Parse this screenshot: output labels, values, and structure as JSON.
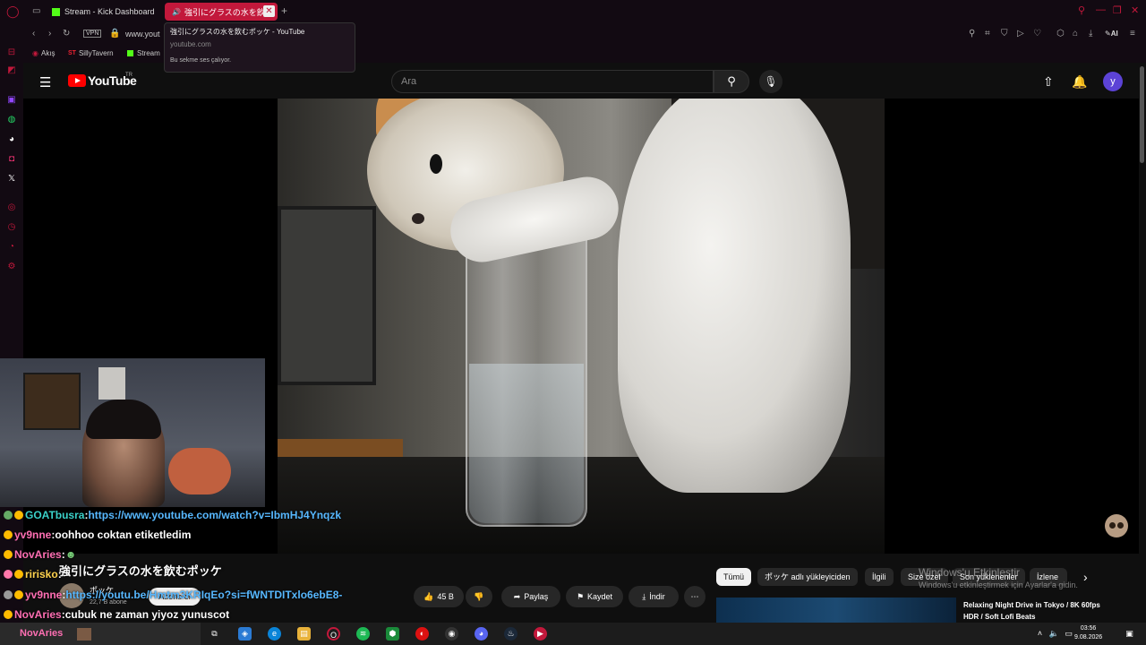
{
  "browser": {
    "tabs": [
      {
        "label": "Stream - Kick Dashboard"
      },
      {
        "label": "強引にグラスの水を飲む"
      }
    ],
    "address": "www.yout",
    "vpn": "VPN",
    "bookmarks": [
      "Akış",
      "SillyTavern",
      "Stream"
    ],
    "ai_label": "AI"
  },
  "tooltip": {
    "title": "強引にグラスの水を飲むポッケ - YouTube",
    "domain": "youtube.com",
    "status": "Bu sekme ses çalıyor."
  },
  "youtube": {
    "logo_text": "YouTube",
    "region": "TR",
    "search_placeholder": "Ara",
    "avatar_letter": "y",
    "video_title": "強引にグラスの水を飲むポッケ",
    "channel": "ポッケ",
    "subscribers": "22,7 B abone",
    "subscribe_label": "Abone ol",
    "likes": "45 B",
    "share": "Paylaş",
    "save": "Kaydet",
    "download": "İndir",
    "chips": [
      "Tümü",
      "ポッケ adlı yükleyiciden",
      "İlgili",
      "Size özel",
      "Son yüklenenler",
      "İzlene"
    ],
    "recommended_title": "Relaxing Night Drive in Tokyo / 8K 60fps HDR / Soft Lofi Beats"
  },
  "windows_activation": {
    "line1": "Windows'u Etkinleştir",
    "line2": "Windows'u etkinleştirmek için Ayarlar'a gidin."
  },
  "chat": [
    {
      "user": "GOATbusra",
      "sep": " : ",
      "text": "https://www.youtube.com/watch?v=IbmHJ4Ynqzk"
    },
    {
      "user": "yv9nne",
      "sep": " : ",
      "text": "oohhoo coktan etiketledim"
    },
    {
      "user": "NovAries",
      "sep": " : ",
      "text": ""
    },
    {
      "user": "ririsko",
      "sep": " : ",
      "text": ""
    },
    {
      "user": "yv9nne",
      "sep": " : ",
      "text": "https://youtu.be/Hmtm3KRIqEo?si=fWNTDITxlo6ebE8-"
    },
    {
      "user": "NovAries",
      "sep": " : ",
      "text": "cubuk ne zaman yiyoz yunuscot"
    }
  ],
  "taskbar": {
    "search_user": "NovAries",
    "time": "03:56",
    "date": "9.08.2026"
  },
  "colors": {
    "opera_red": "#c2183b",
    "yt_red": "#ff0000",
    "kick_green": "#53fc18"
  }
}
